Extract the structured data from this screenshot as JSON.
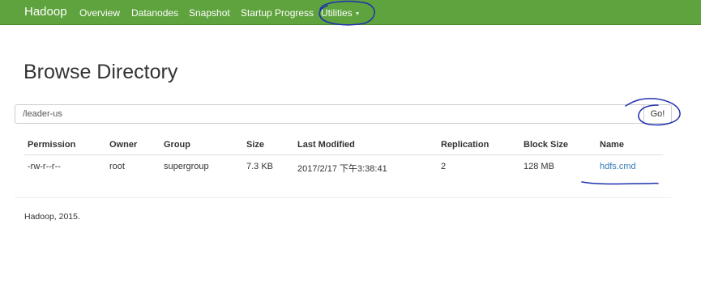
{
  "navbar": {
    "brand": "Hadoop",
    "items": [
      "Overview",
      "Datanodes",
      "Snapshot",
      "Startup Progress",
      "Utilities"
    ]
  },
  "page_title": "Browse Directory",
  "path": {
    "value": "/leader-us",
    "go_label": "Go!"
  },
  "table": {
    "headers": [
      "Permission",
      "Owner",
      "Group",
      "Size",
      "Last Modified",
      "Replication",
      "Block Size",
      "Name"
    ],
    "rows": [
      [
        "-rw-r--r--",
        "root",
        "supergroup",
        "7.3 KB",
        "2017/2/17 下午3:38:41",
        "2",
        "128 MB",
        "hdfs.cmd"
      ]
    ]
  },
  "footer": "Hadoop, 2015.",
  "colors": {
    "navbar_bg": "#5fa33e",
    "link": "#337ab7",
    "annotation_ink": "#1f2fb0"
  }
}
